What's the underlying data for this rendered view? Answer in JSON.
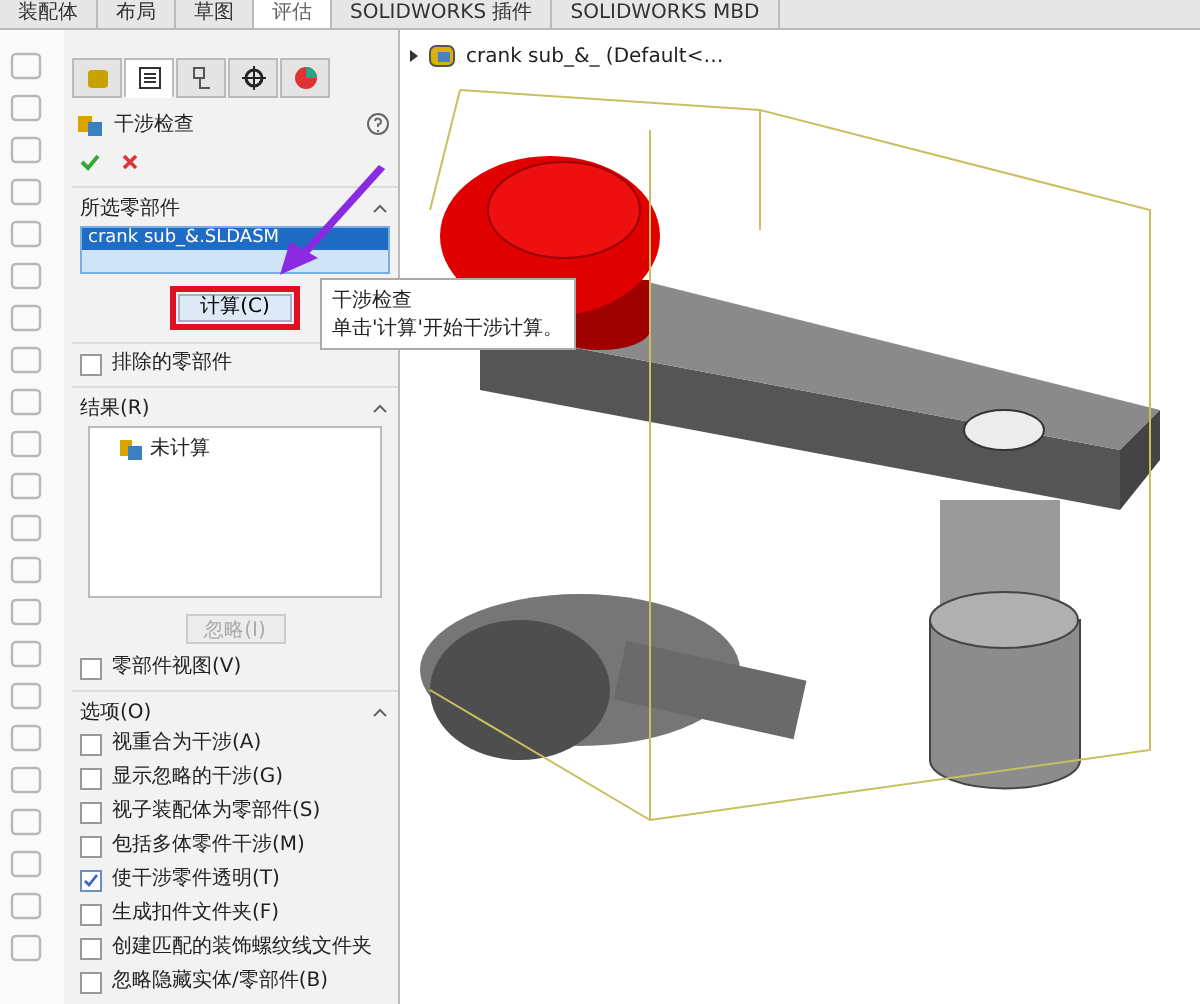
{
  "tabs": [
    {
      "label": "装配体",
      "selected": false
    },
    {
      "label": "布局",
      "selected": false
    },
    {
      "label": "草图",
      "selected": false
    },
    {
      "label": "评估",
      "selected": true
    },
    {
      "label": "SOLIDWORKS 插件",
      "selected": false
    },
    {
      "label": "SOLIDWORKS MBD",
      "selected": false
    }
  ],
  "panel_tabs": [
    {
      "kind": "feature",
      "selected": false
    },
    {
      "kind": "property",
      "selected": true
    },
    {
      "kind": "config",
      "selected": false
    },
    {
      "kind": "dim",
      "selected": false
    },
    {
      "kind": "display",
      "selected": false
    }
  ],
  "panel": {
    "title": "干涉检查",
    "selected_components": {
      "title": "所选零部件",
      "expanded": true,
      "items": [
        {
          "label": "crank sub_&.SLDASM",
          "selected": true
        }
      ]
    },
    "calculate_button": {
      "label": "计算(C)"
    },
    "tooltip": {
      "title": "干涉检查",
      "text": "单击'计算'开始干涉计算。"
    },
    "excluded": {
      "label": "排除的零部件",
      "checked": false
    },
    "results": {
      "title": "结果(R)",
      "expanded": true,
      "items": [
        "未计算"
      ]
    },
    "ignore_button": {
      "label": "忽略(I)",
      "disabled": true
    },
    "component_view": {
      "label": "零部件视图(V)",
      "checked": false
    },
    "options": {
      "title": "选项(O)",
      "expanded": true,
      "items": [
        {
          "label": "视重合为干涉(A)",
          "checked": false
        },
        {
          "label": "显示忽略的干涉(G)",
          "checked": false
        },
        {
          "label": "视子装配体为零部件(S)",
          "checked": false
        },
        {
          "label": "包括多体零件干涉(M)",
          "checked": false
        },
        {
          "label": "使干涉零件透明(T)",
          "checked": true
        },
        {
          "label": "生成扣件文件夹(F)",
          "checked": false
        },
        {
          "label": "创建匹配的装饰螺纹线文件夹",
          "checked": false
        },
        {
          "label": "忽略隐藏实体/零部件(B)",
          "checked": false
        }
      ]
    }
  },
  "viewport": {
    "tree_item": "crank sub_&_ (Default<…"
  }
}
